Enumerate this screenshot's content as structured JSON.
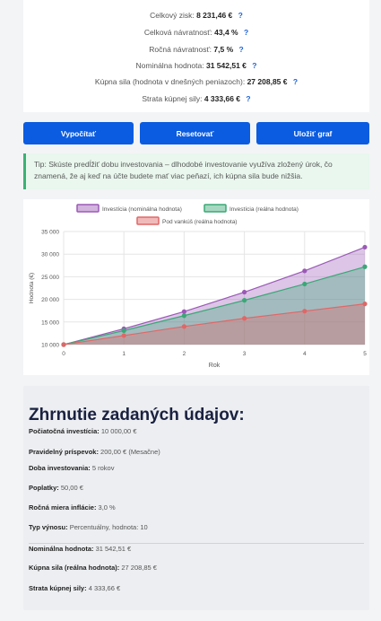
{
  "results": [
    {
      "label": "Celkový zisk:",
      "value": "8 231,46 €"
    },
    {
      "label": "Celková návratnosť:",
      "value": "43,4 %"
    },
    {
      "label": "Ročná návratnosť:",
      "value": "7,5 %"
    },
    {
      "label": "Nominálna hodnota:",
      "value": "31 542,51 €"
    },
    {
      "label": "Kúpna sila (hodnota v dnešných peniazoch):",
      "value": "27 208,85 €"
    },
    {
      "label": "Strata kúpnej sily:",
      "value": "4 333,66 €"
    }
  ],
  "help_glyph": "?",
  "buttons": {
    "calculate": "Vypočítať",
    "reset": "Resetovať",
    "save": "Uložiť graf"
  },
  "tip": "Tip: Skúste predĺžiť dobu investovania – dlhodobé investovanie využíva zložený úrok, čo znamená, že aj keď na účte budete mať viac peňazí, ich kúpna sila bude nižšia.",
  "colors": {
    "accent": "#0b5ce0",
    "tip_bg": "#e9f7ee",
    "tip_border": "#3bb273"
  },
  "chart_data": {
    "type": "area",
    "x": [
      0,
      1,
      2,
      3,
      4,
      5
    ],
    "xlabel": "Rok",
    "ylabel": "Hodnota (€)",
    "ylim": [
      10000,
      35000
    ],
    "yticks": [
      10000,
      15000,
      20000,
      25000,
      30000,
      35000
    ],
    "ytick_labels": [
      "10 000",
      "15 000",
      "20 000",
      "25 000",
      "30 000",
      "35 000"
    ],
    "grid": true,
    "legend": "top",
    "series": [
      {
        "name": "Investícia (nominálna hodnota)",
        "color": "#9b59b6",
        "values": [
          10000,
          13500,
          17300,
          21600,
          26300,
          31542
        ]
      },
      {
        "name": "Investícia (reálna hodnota)",
        "color": "#3aa876",
        "values": [
          10000,
          13100,
          16400,
          19800,
          23400,
          27209
        ]
      },
      {
        "name": "Pod vankúš (reálna hodnota)",
        "color": "#e06767",
        "values": [
          10000,
          12000,
          14000,
          15800,
          17400,
          19000
        ]
      }
    ]
  },
  "summary": {
    "title": "Zhrnutie zadaných údajov:",
    "items": [
      {
        "label": "Počiatočná investícia:",
        "value": "10 000,00 €"
      },
      {
        "label": "Pravidelný príspevok:",
        "value": "200,00 € (Mesačne)"
      },
      {
        "label": "Doba investovania:",
        "value": "5 rokov"
      },
      {
        "label": "Poplatky:",
        "value": "50,00 €"
      },
      {
        "label": "Ročná miera inflácie:",
        "value": "3,0 %"
      },
      {
        "label": "Typ výnosu:",
        "value": "Percentuálny, hodnota: 10"
      },
      {
        "label": "Nominálna hodnota:",
        "value": "31 542,51 €"
      },
      {
        "label": "Kúpna sila (reálna hodnota):",
        "value": "27 208,85 €"
      },
      {
        "label": "Strata kúpnej sily:",
        "value": "4 333,66 €"
      }
    ]
  }
}
